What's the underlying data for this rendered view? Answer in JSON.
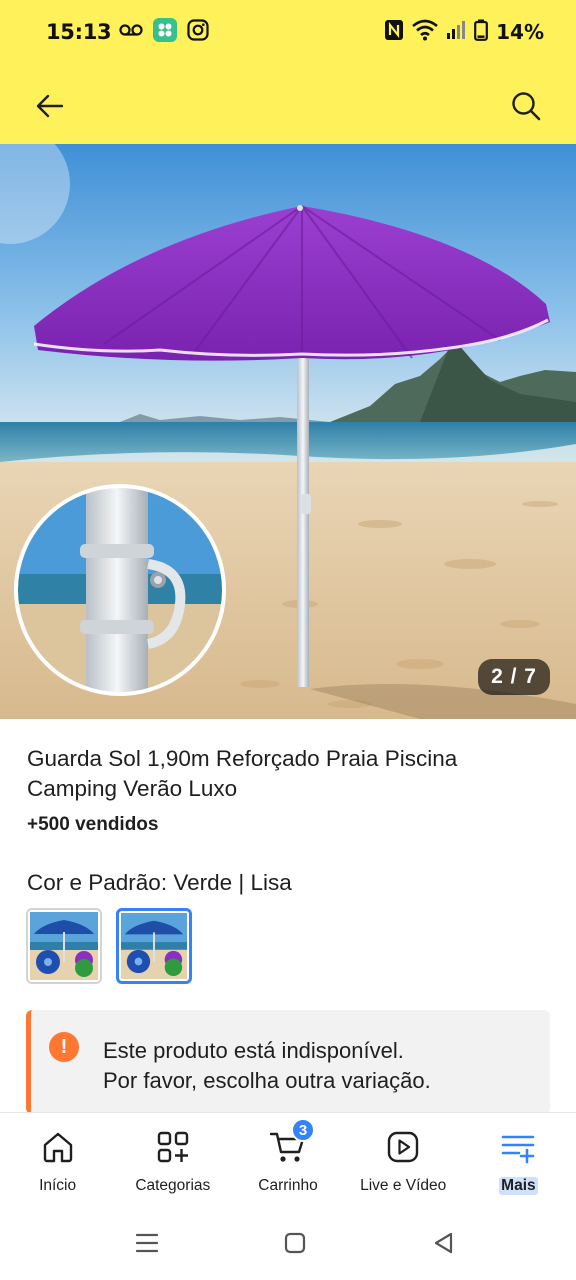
{
  "status_bar": {
    "time": "15:13",
    "battery": "14%"
  },
  "app_bar": {
    "back_icon": "arrow-left-icon",
    "search_icon": "search-icon"
  },
  "gallery": {
    "counter": "2 / 7"
  },
  "product": {
    "title": "Guarda Sol 1,90m Reforçado Praia Piscina Camping Verão Luxo",
    "sold": "+500 vendidos",
    "variation_label": "Cor e Padrão: Verde | Lisa",
    "variations": [
      {
        "name": "variation-1",
        "selected": false
      },
      {
        "name": "variation-2",
        "selected": true
      }
    ]
  },
  "notice": {
    "icon": "!",
    "line1": "Este produto está indisponível.",
    "line2": "Por favor, escolha outra variação."
  },
  "bottom_nav": {
    "items": [
      {
        "label": "Início",
        "icon": "home-icon"
      },
      {
        "label": "Categorias",
        "icon": "categories-icon"
      },
      {
        "label": "Carrinho",
        "icon": "cart-icon",
        "badge": "3"
      },
      {
        "label": "Live e Vídeo",
        "icon": "play-icon"
      },
      {
        "label": "Mais",
        "icon": "menu-plus-icon",
        "active": true
      }
    ]
  },
  "colors": {
    "brand_yellow": "#fff159",
    "accent_blue": "#3483fa",
    "warning_orange": "#ff7733",
    "umbrella_purple": "#8a2fc0"
  }
}
